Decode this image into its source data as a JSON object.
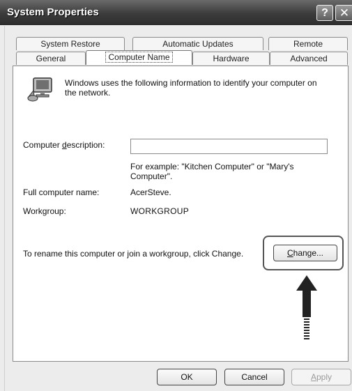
{
  "window": {
    "title": "System Properties",
    "help_glyph": "?",
    "close_glyph": "✕"
  },
  "tabs_row_back": [
    {
      "label": "System Restore"
    },
    {
      "label": "Automatic Updates"
    },
    {
      "label": "Remote"
    }
  ],
  "tabs_row_front": [
    {
      "label": "General"
    },
    {
      "label": "Computer Name",
      "active": true
    },
    {
      "label": "Hardware"
    },
    {
      "label": "Advanced"
    }
  ],
  "panel": {
    "intro_text": "Windows uses the following information to identify your computer on the network.",
    "description_label_pre": "Computer ",
    "description_label_mnemonic": "d",
    "description_label_post": "escription:",
    "description_value": "",
    "example_text": "For example: \"Kitchen Computer\" or \"Mary's Computer\".",
    "full_name_label": "Full computer name:",
    "full_name_value": "AcerSteve.",
    "workgroup_label": "Workgroup:",
    "workgroup_value": "WORKGROUP",
    "rename_text": "To rename this computer or join a workgroup, click Change.",
    "change_button_mnemonic": "C",
    "change_button_rest": "hange..."
  },
  "buttons": {
    "ok": "OK",
    "cancel": "Cancel",
    "apply_mnemonic": "A",
    "apply_rest": "pply"
  }
}
